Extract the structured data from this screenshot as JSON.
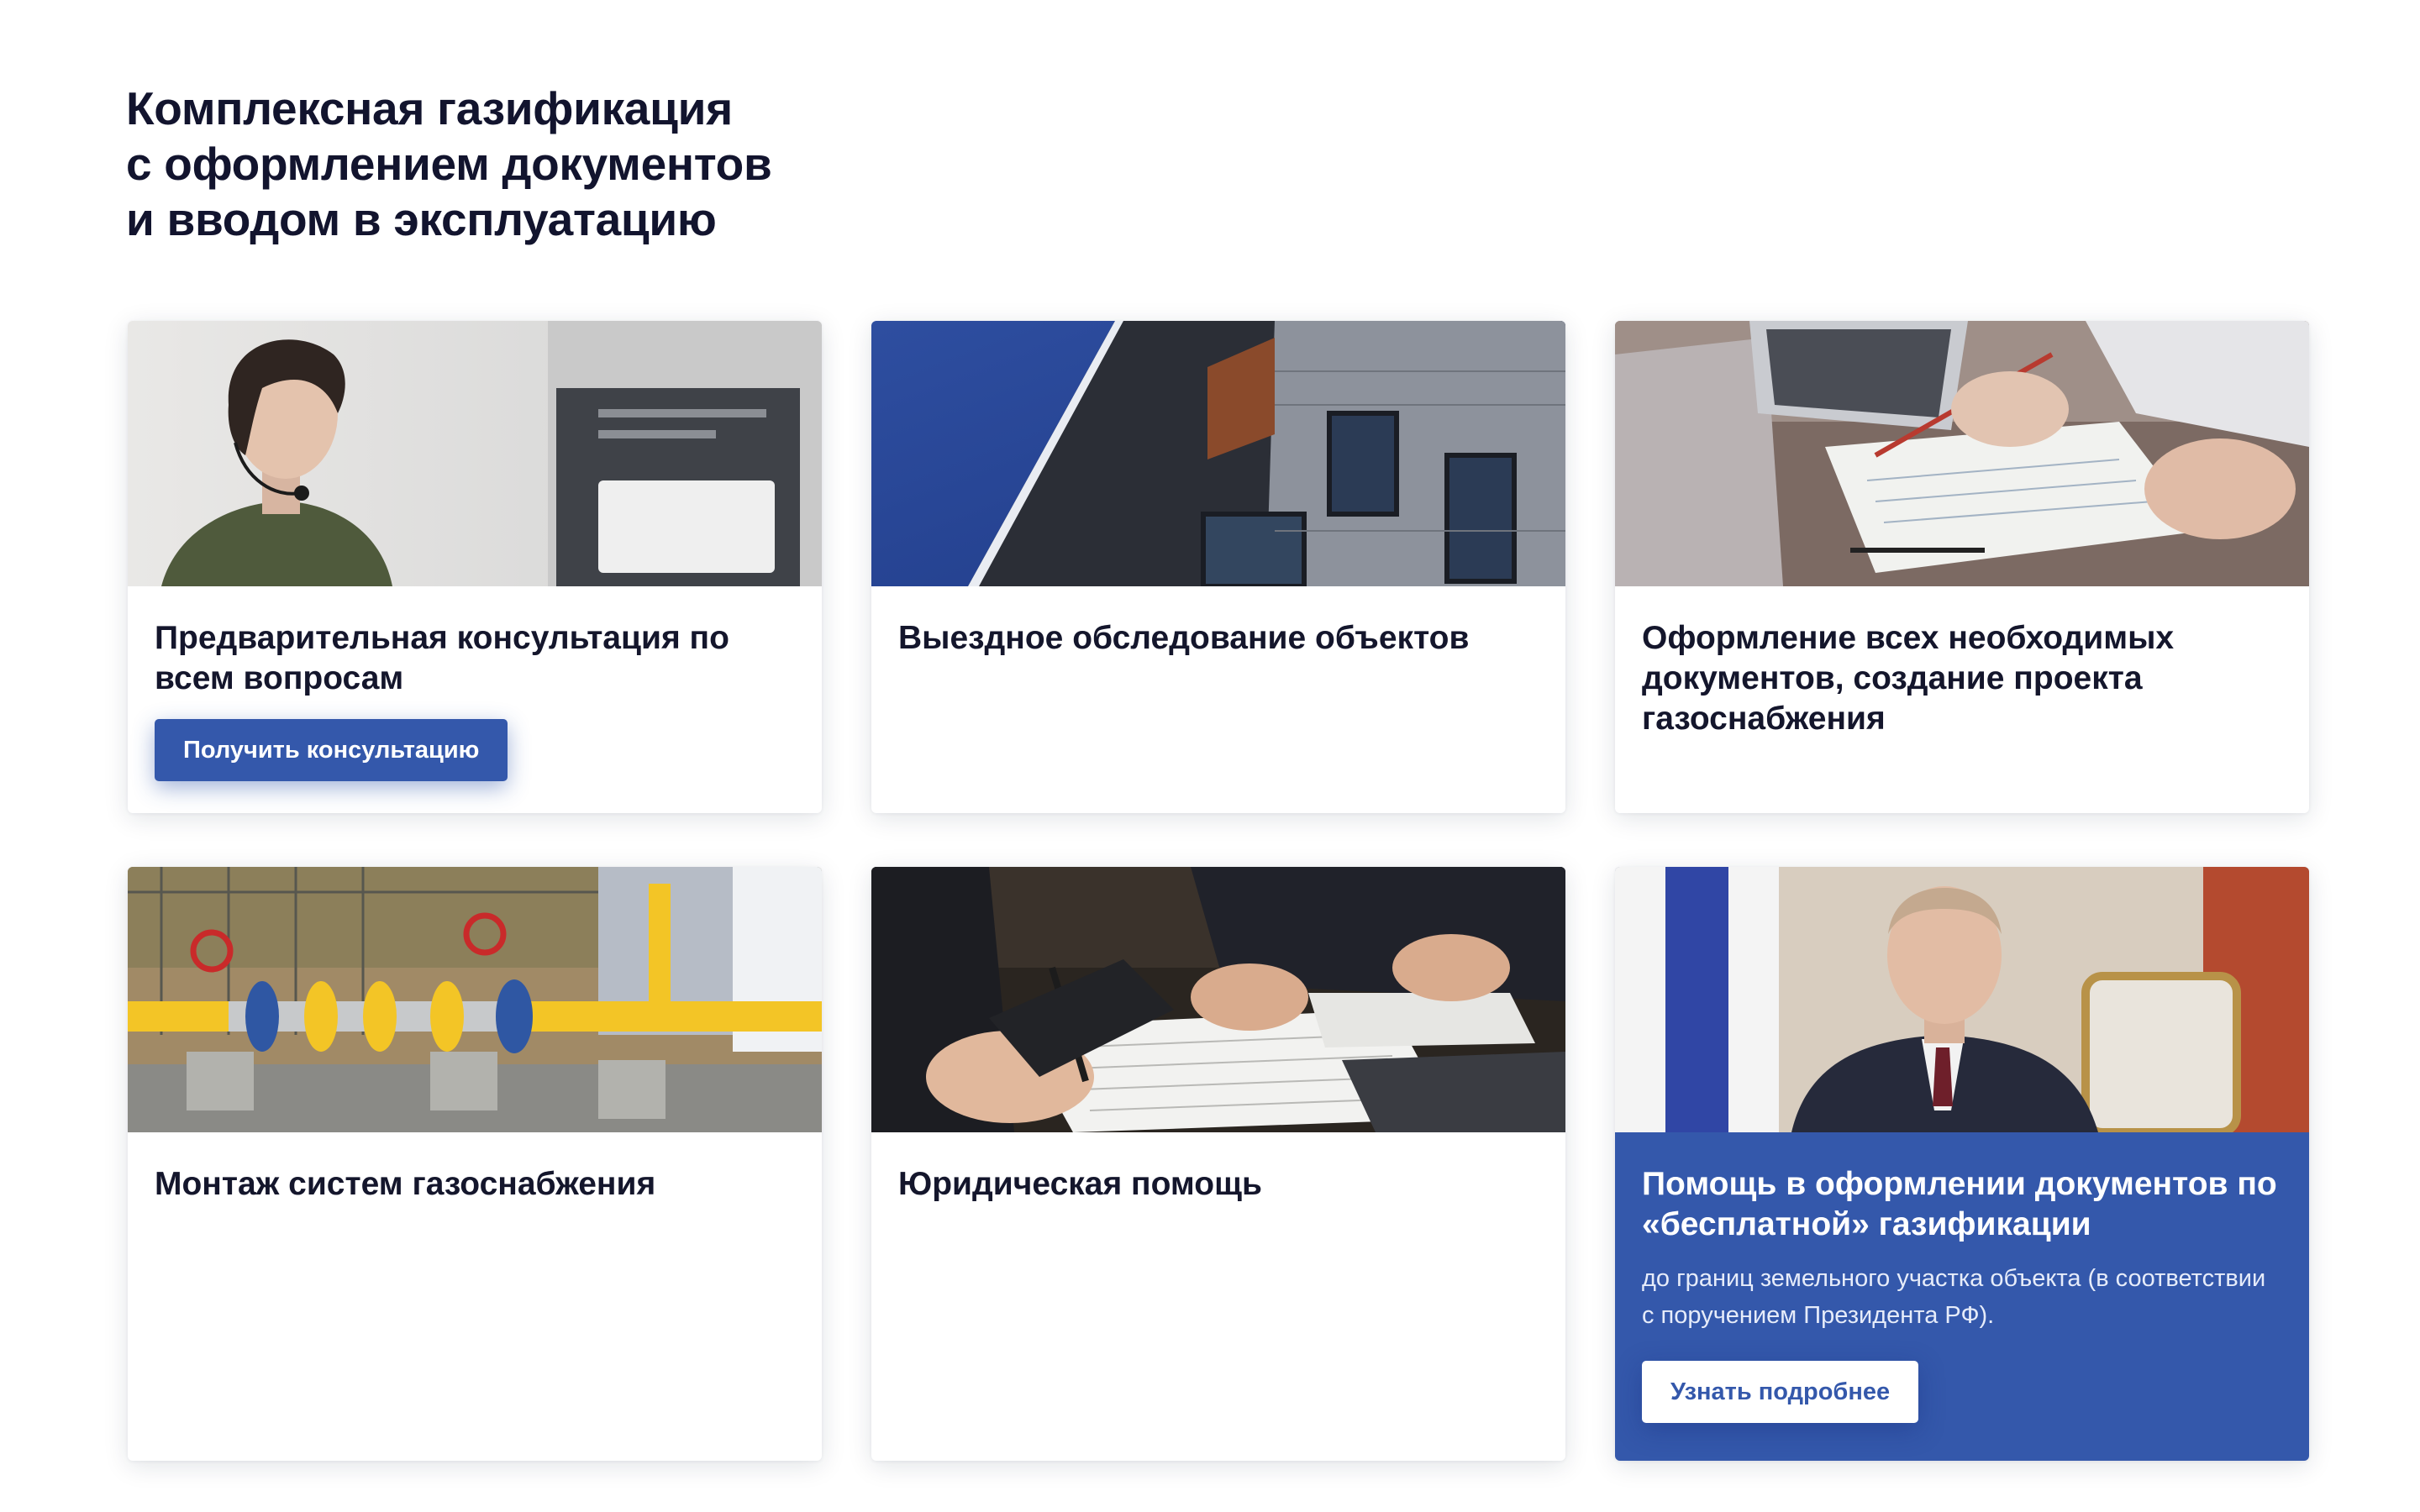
{
  "section": {
    "title_lines": [
      "Комплексная газификация",
      "с оформлением документов",
      "и вводом в эксплуатацию"
    ]
  },
  "colors": {
    "accent": "#3458ab",
    "title": "#12142e",
    "card_bg": "#ffffff"
  },
  "cards": [
    {
      "title": "Предварительная консультация по всем вопросам",
      "image": "call-center-operator-photo",
      "button": "Получить консультацию"
    },
    {
      "title": "Выездное обследование объектов",
      "image": "building-facade-photo"
    },
    {
      "title": "Оформление всех необходимых документов, создание проекта газоснабжения",
      "image": "documents-on-desk-photo"
    },
    {
      "title": "Монтаж систем газоснабжения",
      "image": "gas-pipeline-photo"
    },
    {
      "title": "Юридическая помощь",
      "image": "signing-contract-photo"
    },
    {
      "title": "Помощь в оформлении документов по «бесплатной» газификации",
      "description": "до границ земельного участка объекта (в соответствии с поручением Президента РФ).",
      "image": "president-photo",
      "button": "Узнать подробнее"
    }
  ]
}
